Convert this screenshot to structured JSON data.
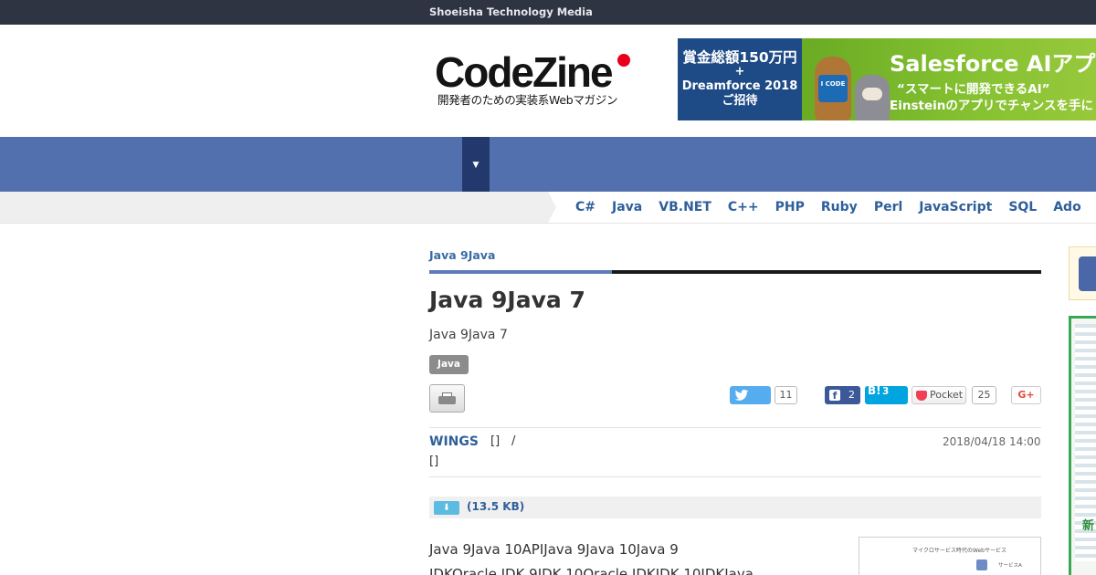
{
  "topbar": {
    "text": "Shoeisha Technology Media"
  },
  "header": {
    "logo": {
      "name": "CodeZine",
      "tagline": "開発者のための実装系Webマガジン"
    },
    "banner": {
      "left_line1": "賞金総額150万円",
      "left_line2": "+",
      "left_line3": "Dreamforce 2018",
      "left_line4": "ご招待",
      "title": "Salesforce AIアプリ",
      "sub1": "“スマートに開発できるAI”",
      "sub2": "Einsteinのアプリでチャンスを手に",
      "mascot_shirt": "I CODE"
    }
  },
  "nav": {
    "dropdown_icon": "▼"
  },
  "languages": [
    "C#",
    "Java",
    "VB.NET",
    "C++",
    "PHP",
    "Ruby",
    "Perl",
    "JavaScript",
    "SQL",
    "Ado"
  ],
  "article": {
    "category": "Java 9Java",
    "title": "Java 9Java 7",
    "subtitle": "Java 9Java 7",
    "tag": "Java",
    "share": {
      "twitter_count": "11",
      "facebook_count": "2",
      "hatena_count": "3",
      "hatena_label": "B!",
      "pocket_label": "Pocket",
      "pocket_count": "25",
      "gplus_label": "G+"
    },
    "author": "WINGS",
    "author_bracket": "[]",
    "author_slash": "/",
    "author_line2": "[]",
    "date": "2018/04/18 14:00",
    "download_icon": "⬇",
    "download_text": "(13.5 KB)",
    "body_line1": "Java 9Java 10APIJava 9Java 10Java 9",
    "body_line2": "JDKOracle JDK 9JDK 10Oracle JDKJDK 10JDKJava",
    "figure": {
      "caption": "マイクロサービス時代のWebサービス",
      "label": "サービスA"
    }
  },
  "sidebar": {
    "ad_text": "新"
  },
  "colors": {
    "topbar": "#2f3442",
    "nav": "#5170ad",
    "nav_dropdown": "#23396d",
    "link": "#2f5f9a",
    "twitter": "#55acee",
    "facebook": "#3b5998",
    "hatena": "#00a4de",
    "pocket": "#ef4056"
  }
}
